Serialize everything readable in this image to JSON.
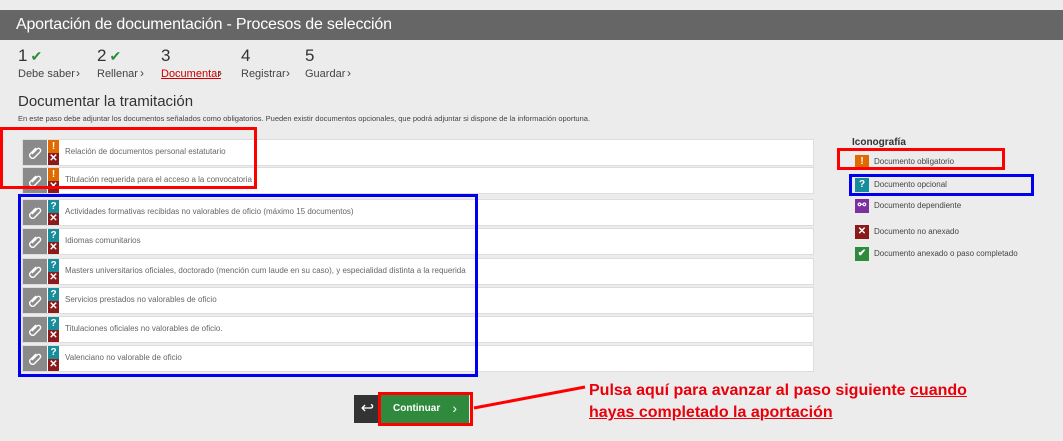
{
  "window": {
    "title": "Aportación de documentación - Procesos de selección"
  },
  "steps": [
    {
      "num": "1",
      "label": "Debe saber",
      "done": true
    },
    {
      "num": "2",
      "label": "Rellenar",
      "done": true
    },
    {
      "num": "3",
      "label": "Documentar",
      "active": true
    },
    {
      "num": "4",
      "label": "Registrar"
    },
    {
      "num": "5",
      "label": "Guardar"
    }
  ],
  "section": {
    "title": "Documentar la tramitación",
    "description": "En este paso debe adjuntar los documentos señalados como obligatorios. Pueden existir documentos opcionales, que podrá adjuntar si dispone de la información oportuna."
  },
  "required_docs": [
    "Relación de documentos personal estatutario",
    "Titulación requerida para el acceso a la convocatoria"
  ],
  "optional_docs": [
    "Actividades formativas recibidas no valorables de oficio (máximo 15 documentos)",
    "Idiomas comunitarios",
    "Masters universitarios oficiales, doctorado (mención cum laude en su caso), y especialidad distinta a la requerida",
    "Servicios prestados no valorables de oficio",
    "Titulaciones oficiales no valorables de oficio.",
    "Valenciano no valorable de oficio"
  ],
  "legend": {
    "title": "Iconografía",
    "items": [
      {
        "icon": "!",
        "label": "Documento obligatorio",
        "color": "#e06a00"
      },
      {
        "icon": "?",
        "label": "Documento opcional",
        "color": "#198c9b"
      },
      {
        "icon": "link",
        "label": "Documento dependiente",
        "color": "#7b2fa0"
      },
      {
        "icon": "x",
        "label": "Documento no anexado",
        "color": "#8b1a1a"
      },
      {
        "icon": "check",
        "label": "Documento anexado o paso completado",
        "color": "#2f8a3e"
      }
    ]
  },
  "buttons": {
    "continue": "Continuar",
    "back_icon": "back-arrow-icon"
  },
  "annotation": {
    "line1": "Pulsa aquí para avanzar al paso siguiente ",
    "line1_u": "cuando",
    "line2_u": "hayas completado la aportación"
  },
  "colors": {
    "header": "#666666",
    "accent_red": "#ff0000",
    "accent_blue": "#0000ee",
    "button_green": "#2f8a3e"
  }
}
